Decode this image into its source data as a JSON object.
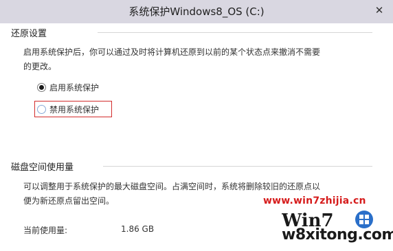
{
  "window": {
    "title": "系统保护Windows8_OS (C:)",
    "close_glyph": "✕"
  },
  "restore": {
    "heading": "还原设置",
    "description_line1": "启用系统保护后，你可以通过及时将计算机还原到以前的某个状态点来撤消不需要",
    "description_line2": "的更改。",
    "options": [
      {
        "label": "启用系统保护",
        "selected": true
      },
      {
        "label": "禁用系统保护",
        "selected": false
      }
    ]
  },
  "disk": {
    "heading": "磁盘空间使用量",
    "description_line1": "可以调整用于系统保护的最大磁盘空间。占满空间时，系统将删除较旧的还原点以",
    "description_line2": "便为新还原点留出空间。",
    "current_usage_label": "当前使用量:",
    "current_usage_value": "1.86 GB"
  },
  "watermark": {
    "url": "www.win7zhijia.cn",
    "logo_text": "Win7",
    "site": "w8xitong.com"
  },
  "colors": {
    "titlebar": "#d9d7e1",
    "highlight_border": "#d22b2b",
    "watermark_red": "#d61c1c"
  }
}
